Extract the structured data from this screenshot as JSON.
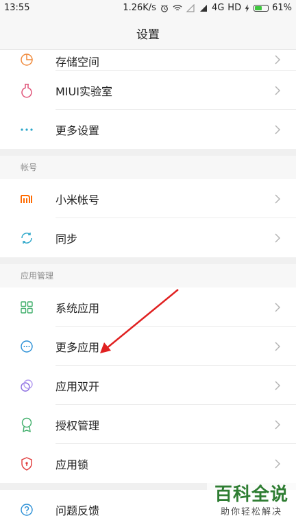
{
  "status": {
    "time": "13:55",
    "speed": "1.26K/s",
    "network": "4G",
    "hd": "HD",
    "battery": "61%",
    "battery_level": 0.61
  },
  "header": {
    "title": "设置"
  },
  "groups": [
    {
      "items": [
        {
          "label": "存储空间",
          "icon": "storage-icon"
        },
        {
          "label": "MIUI实验室",
          "icon": "lab-icon"
        },
        {
          "label": "更多设置",
          "icon": "more-dots-icon"
        }
      ]
    },
    {
      "header": "帐号",
      "items": [
        {
          "label": "小米帐号",
          "icon": "mi-account-icon"
        },
        {
          "label": "同步",
          "icon": "sync-icon"
        }
      ]
    },
    {
      "header": "应用管理",
      "items": [
        {
          "label": "系统应用",
          "icon": "grid-icon"
        },
        {
          "label": "更多应用",
          "icon": "more-apps-icon"
        },
        {
          "label": "应用双开",
          "icon": "dual-apps-icon"
        },
        {
          "label": "授权管理",
          "icon": "permission-icon"
        },
        {
          "label": "应用锁",
          "icon": "app-lock-icon"
        }
      ]
    },
    {
      "items": [
        {
          "label": "问题反馈",
          "icon": "feedback-icon"
        }
      ]
    }
  ],
  "watermark": {
    "main": "百科全说",
    "sub": "助你轻松解决"
  },
  "colors": {
    "accent_red": "#e02020",
    "storage": "#f08a3c",
    "lab": "#e0557a",
    "dots": "#2aa6c9",
    "mi": "#ff6a00",
    "sync": "#2aa6c9",
    "grid": "#3fae6a",
    "more_apps": "#2a8fd6",
    "dual": "#8a6be0",
    "permission": "#3fae6a",
    "lock": "#e03a3a",
    "feedback": "#2a8fd6"
  }
}
